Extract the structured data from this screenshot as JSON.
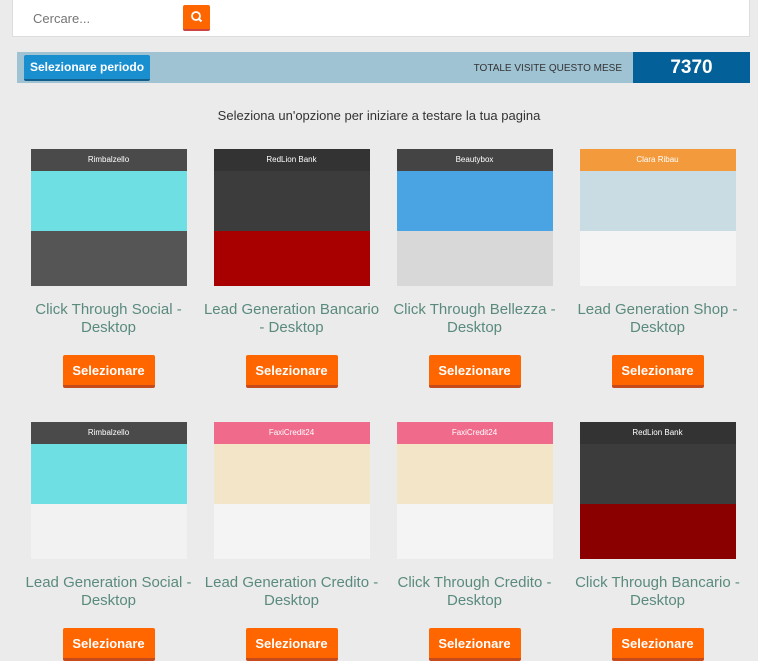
{
  "search": {
    "placeholder": "Cercare..."
  },
  "stats": {
    "period_button": "Selezionare periodo",
    "visits_label": "TOTALE VISITE QUESTO MESE",
    "visits_value": "7370"
  },
  "intro": "Seleziona un'opzione per iniziare a testare la tua pagina",
  "templates": [
    {
      "title": "Click Through Social - Desktop",
      "button": "Selezionare",
      "logo": "Rimbalzello",
      "colors": [
        "#4a4a4a",
        "#6ee0e3",
        "#555555"
      ]
    },
    {
      "title": "Lead Generation Bancario - Desktop",
      "button": "Selezionare",
      "logo": "RedLion Bank",
      "colors": [
        "#333333",
        "#3c3c3c",
        "#a80000"
      ]
    },
    {
      "title": "Click Through Bellezza - Desktop",
      "button": "Selezionare",
      "logo": "Beautybox",
      "colors": [
        "#444444",
        "#4aa3e3",
        "#d8d8d8"
      ]
    },
    {
      "title": "Lead Generation Shop - Desktop",
      "button": "Selezionare",
      "logo": "Clara Ribau",
      "colors": [
        "#f39a3c",
        "#c9dbe3",
        "#f4f4f4"
      ]
    },
    {
      "title": "Lead Generation Social - Desktop",
      "button": "Selezionare",
      "logo": "Rimbalzello",
      "colors": [
        "#4a4a4a",
        "#6ee0e3",
        "#f2f2f2"
      ]
    },
    {
      "title": "Lead Generation Credito - Desktop",
      "button": "Selezionare",
      "logo": "FaxiCredit24",
      "colors": [
        "#f06a8c",
        "#f3e6c8",
        "#f4f4f4"
      ]
    },
    {
      "title": "Click Through Credito - Desktop",
      "button": "Selezionare",
      "logo": "FaxiCredit24",
      "colors": [
        "#f06a8c",
        "#f3e6c8",
        "#f4f4f4"
      ]
    },
    {
      "title": "Click Through Bancario - Desktop",
      "button": "Selezionare",
      "logo": "RedLion Bank",
      "colors": [
        "#333333",
        "#3c3c3c",
        "#8a0000"
      ]
    }
  ]
}
